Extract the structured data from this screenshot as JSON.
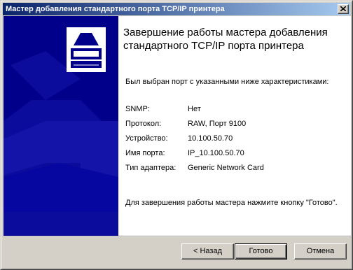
{
  "window": {
    "title": "Мастер добавления стандартного порта TCP/IP принтера"
  },
  "header": {
    "title": "Завершение работы мастера добавления стандартного TCP/IP порта принтера"
  },
  "intro_text": "Был выбран порт с указанными ниже характеристиками:",
  "properties": [
    {
      "label": "SNMP:",
      "value": "Нет"
    },
    {
      "label": "Протокол:",
      "value": "RAW, Порт 9100"
    },
    {
      "label": "Устройство:",
      "value": "10.100.50.70"
    },
    {
      "label": "Имя порта:",
      "value": "IP_10.100.50.70"
    },
    {
      "label": "Тип адаптера:",
      "value": "Generic Network Card"
    }
  ],
  "finish_hint": "Для завершения работы мастера нажмите кнопку \"Готово\".",
  "buttons": {
    "back": "< Назад",
    "finish": "Готово",
    "cancel": "Отмена"
  },
  "icons": {
    "close": "close-icon",
    "wizard_art": "printer-icon"
  },
  "colors": {
    "titlebar_start": "#0a246a",
    "titlebar_end": "#a6caf0",
    "banner": "#00008a",
    "face": "#d4d0c8"
  }
}
